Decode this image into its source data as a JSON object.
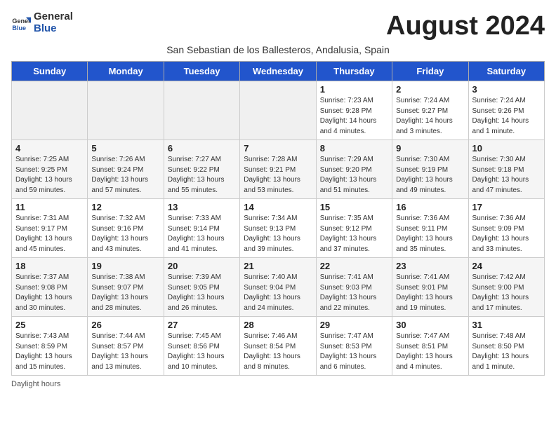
{
  "header": {
    "logo_general": "General",
    "logo_blue": "Blue",
    "month_title": "August 2024",
    "subtitle": "San Sebastian de los Ballesteros, Andalusia, Spain"
  },
  "days_of_week": [
    "Sunday",
    "Monday",
    "Tuesday",
    "Wednesday",
    "Thursday",
    "Friday",
    "Saturday"
  ],
  "weeks": [
    [
      {
        "day": "",
        "info": ""
      },
      {
        "day": "",
        "info": ""
      },
      {
        "day": "",
        "info": ""
      },
      {
        "day": "",
        "info": ""
      },
      {
        "day": "1",
        "info": "Sunrise: 7:23 AM\nSunset: 9:28 PM\nDaylight: 14 hours\nand 4 minutes."
      },
      {
        "day": "2",
        "info": "Sunrise: 7:24 AM\nSunset: 9:27 PM\nDaylight: 14 hours\nand 3 minutes."
      },
      {
        "day": "3",
        "info": "Sunrise: 7:24 AM\nSunset: 9:26 PM\nDaylight: 14 hours\nand 1 minute."
      }
    ],
    [
      {
        "day": "4",
        "info": "Sunrise: 7:25 AM\nSunset: 9:25 PM\nDaylight: 13 hours\nand 59 minutes."
      },
      {
        "day": "5",
        "info": "Sunrise: 7:26 AM\nSunset: 9:24 PM\nDaylight: 13 hours\nand 57 minutes."
      },
      {
        "day": "6",
        "info": "Sunrise: 7:27 AM\nSunset: 9:22 PM\nDaylight: 13 hours\nand 55 minutes."
      },
      {
        "day": "7",
        "info": "Sunrise: 7:28 AM\nSunset: 9:21 PM\nDaylight: 13 hours\nand 53 minutes."
      },
      {
        "day": "8",
        "info": "Sunrise: 7:29 AM\nSunset: 9:20 PM\nDaylight: 13 hours\nand 51 minutes."
      },
      {
        "day": "9",
        "info": "Sunrise: 7:30 AM\nSunset: 9:19 PM\nDaylight: 13 hours\nand 49 minutes."
      },
      {
        "day": "10",
        "info": "Sunrise: 7:30 AM\nSunset: 9:18 PM\nDaylight: 13 hours\nand 47 minutes."
      }
    ],
    [
      {
        "day": "11",
        "info": "Sunrise: 7:31 AM\nSunset: 9:17 PM\nDaylight: 13 hours\nand 45 minutes."
      },
      {
        "day": "12",
        "info": "Sunrise: 7:32 AM\nSunset: 9:16 PM\nDaylight: 13 hours\nand 43 minutes."
      },
      {
        "day": "13",
        "info": "Sunrise: 7:33 AM\nSunset: 9:14 PM\nDaylight: 13 hours\nand 41 minutes."
      },
      {
        "day": "14",
        "info": "Sunrise: 7:34 AM\nSunset: 9:13 PM\nDaylight: 13 hours\nand 39 minutes."
      },
      {
        "day": "15",
        "info": "Sunrise: 7:35 AM\nSunset: 9:12 PM\nDaylight: 13 hours\nand 37 minutes."
      },
      {
        "day": "16",
        "info": "Sunrise: 7:36 AM\nSunset: 9:11 PM\nDaylight: 13 hours\nand 35 minutes."
      },
      {
        "day": "17",
        "info": "Sunrise: 7:36 AM\nSunset: 9:09 PM\nDaylight: 13 hours\nand 33 minutes."
      }
    ],
    [
      {
        "day": "18",
        "info": "Sunrise: 7:37 AM\nSunset: 9:08 PM\nDaylight: 13 hours\nand 30 minutes."
      },
      {
        "day": "19",
        "info": "Sunrise: 7:38 AM\nSunset: 9:07 PM\nDaylight: 13 hours\nand 28 minutes."
      },
      {
        "day": "20",
        "info": "Sunrise: 7:39 AM\nSunset: 9:05 PM\nDaylight: 13 hours\nand 26 minutes."
      },
      {
        "day": "21",
        "info": "Sunrise: 7:40 AM\nSunset: 9:04 PM\nDaylight: 13 hours\nand 24 minutes."
      },
      {
        "day": "22",
        "info": "Sunrise: 7:41 AM\nSunset: 9:03 PM\nDaylight: 13 hours\nand 22 minutes."
      },
      {
        "day": "23",
        "info": "Sunrise: 7:41 AM\nSunset: 9:01 PM\nDaylight: 13 hours\nand 19 minutes."
      },
      {
        "day": "24",
        "info": "Sunrise: 7:42 AM\nSunset: 9:00 PM\nDaylight: 13 hours\nand 17 minutes."
      }
    ],
    [
      {
        "day": "25",
        "info": "Sunrise: 7:43 AM\nSunset: 8:59 PM\nDaylight: 13 hours\nand 15 minutes."
      },
      {
        "day": "26",
        "info": "Sunrise: 7:44 AM\nSunset: 8:57 PM\nDaylight: 13 hours\nand 13 minutes."
      },
      {
        "day": "27",
        "info": "Sunrise: 7:45 AM\nSunset: 8:56 PM\nDaylight: 13 hours\nand 10 minutes."
      },
      {
        "day": "28",
        "info": "Sunrise: 7:46 AM\nSunset: 8:54 PM\nDaylight: 13 hours\nand 8 minutes."
      },
      {
        "day": "29",
        "info": "Sunrise: 7:47 AM\nSunset: 8:53 PM\nDaylight: 13 hours\nand 6 minutes."
      },
      {
        "day": "30",
        "info": "Sunrise: 7:47 AM\nSunset: 8:51 PM\nDaylight: 13 hours\nand 4 minutes."
      },
      {
        "day": "31",
        "info": "Sunrise: 7:48 AM\nSunset: 8:50 PM\nDaylight: 13 hours\nand 1 minute."
      }
    ]
  ],
  "footer": {
    "daylight_label": "Daylight hours"
  }
}
